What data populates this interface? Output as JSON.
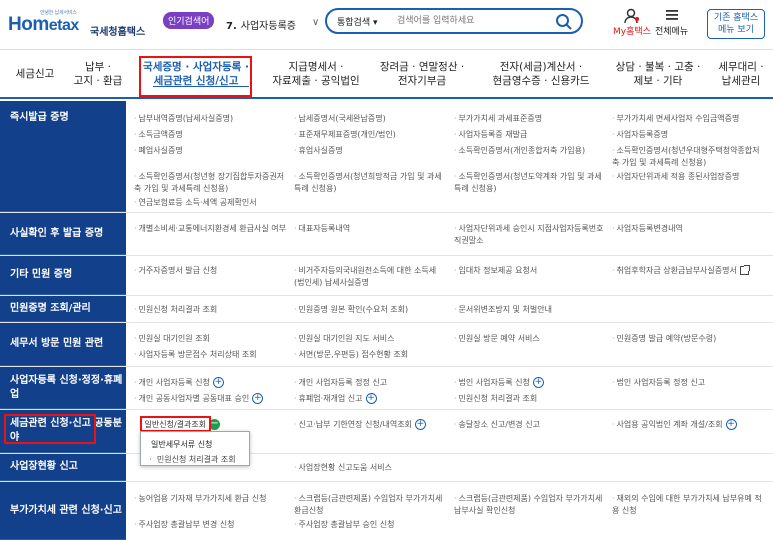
{
  "header": {
    "logo_tagline": "안녕한 납세서비스",
    "logo_home": "Hom",
    "logo_tax": "etax",
    "logo_org": "국세청홈택스",
    "popular_badge": "인기검색어",
    "popular_rank": "7.",
    "popular_term": "사업자등록증",
    "search_scope": "통합검색",
    "search_placeholder": "검색어를 입력하세요",
    "my_label": "My홈택스",
    "menu_label": "전체메뉴",
    "old_button_line1": "기존 홈택스",
    "old_button_line2": "메뉴 보기"
  },
  "gnb": [
    {
      "l1": "세금신고",
      "l2": ""
    },
    {
      "l1": "납부 ·",
      "l2": "고지 · 환급"
    },
    {
      "l1": "국세증명 · 사업자등록 ·",
      "l2": "세금관련 신청/신고"
    },
    {
      "l1": "지급명세서 ·",
      "l2": "자료제출 · 공익법인"
    },
    {
      "l1": "장려금 · 연말정산 ·",
      "l2": "전자기부금"
    },
    {
      "l1": "전자(세금)계산서 ·",
      "l2": "현금영수증 · 신용카드"
    },
    {
      "l1": "상담 · 불복 · 고충 ·",
      "l2": "제보 · 기타"
    },
    {
      "l1": "세무대리 ·",
      "l2": "납세관리"
    }
  ],
  "rows": [
    {
      "title": "즉시발급 증명"
    },
    {
      "title": "사실확인 후 발급 증명"
    },
    {
      "title": "기타 민원 증명"
    },
    {
      "title": "민원증명 조회/관리"
    },
    {
      "title": "세무서 방문 민원 관련"
    },
    {
      "title": "사업자등록 신청·정정·휴폐업"
    },
    {
      "title": "세금관련 신청·신고 공동분야"
    },
    {
      "title": "사업장현황 신고"
    },
    {
      "title": "부가가치세 관련 신청·신고"
    }
  ],
  "cells": {
    "r0": [
      "납부내역증명(납세사실증명)",
      "납세증명서(국세완납증명)",
      "부가가치세 과세표준증명",
      "부가가치세 면세사업자 수입금액증명",
      "소득금액증명",
      "표준재무제표증명(개인/법인)",
      "사업자등록증 재발급",
      "사업자등록증명",
      "폐업사실증명",
      "휴업사실증명",
      "소득확인증명서(개인종합저축 가입용)",
      "소득확인증명서(청년우대형주택청약종합저축 가입 및 과세특례 신청용)",
      "소득확인증명서(청년형 장기집합투자증권저축 가입 및 과세특례 신청용)",
      "소득확인증명서(청년희망적금 가입 및 과세특례 신청용)",
      "소득확인증명서(청년도약계좌 가입 및 과세특례 신청용)",
      "사업자단위과세 적용 종된사업장증명",
      "연금보험료등 소득·세액 공제확인서"
    ],
    "r1": [
      "개별소비세·교통에너지환경세 환급사실 여부",
      "대표자등록내역",
      "사업자단위과세 승인시 지점사업자등록번호 직권말소",
      "사업자등록변경내역"
    ],
    "r2": [
      "거주자증명서 발급 신청",
      "비거주자등의국내원천소득에 대한 소득세(법인세) 납세사실증명",
      "임대차 정보제공 요청서",
      "취업후학자금 상환금납부사실증명서"
    ],
    "r3": [
      "민원신청 처리결과 조회",
      "민원증명 원본 확인(수요처 조회)",
      "문서위변조방지 및 처벌안내"
    ],
    "r4": [
      "민원실 대기인원 조회",
      "민원실 대기인원 지도 서비스",
      "민원실 방문 예약 서비스",
      "민원증명 발급 예약(방문수령)",
      "사업자등록 방문접수 처리상태 조회",
      "서면(방문,우편등) 접수현황 조회"
    ],
    "r5": [
      "개인 사업자등록 신청",
      "개인 사업자등록 정정 신고",
      "법인 사업자등록 신청",
      "법인 사업자등록 정정 신고",
      "개인 공동사업자별 공동대표 승인",
      "휴폐업·재개업 신고",
      "민원신청 처리결과 조회"
    ],
    "r6": [
      "일반신청/결과조회",
      "신고·납부 기한연장 신청/내역조회",
      "송달장소 신고/변경 신고",
      "사업용 공익법인 계좌 개설/조회"
    ],
    "r7": [
      "사업장현황 신고도움 서비스"
    ],
    "r8": [
      "농어업용 기자재 부가가치세 환급 신청",
      "스크랩등(금관련제품) 수입업자 부가가치세 환급신청",
      "스크랩등(금관련제품) 수입업자 부가가치세 납부사실 확인신청",
      "재외의 수입에 대한 부가가치세 납부유예 적용 신청",
      "주사업장 총괄납부 변경 신청",
      "주사업장 총괄납부 승인 신청"
    ]
  },
  "dropdown": {
    "item1": "일반세무서류 신청",
    "item2": "민원신청 처리결과 조회"
  },
  "colors": {
    "brand_blue": "#1b5fb4",
    "row_header_navy": "#13408a",
    "highlight_red": "#ee1111",
    "badge_purple": "#7b3fc4",
    "toggle_green": "#1b9e4f"
  }
}
